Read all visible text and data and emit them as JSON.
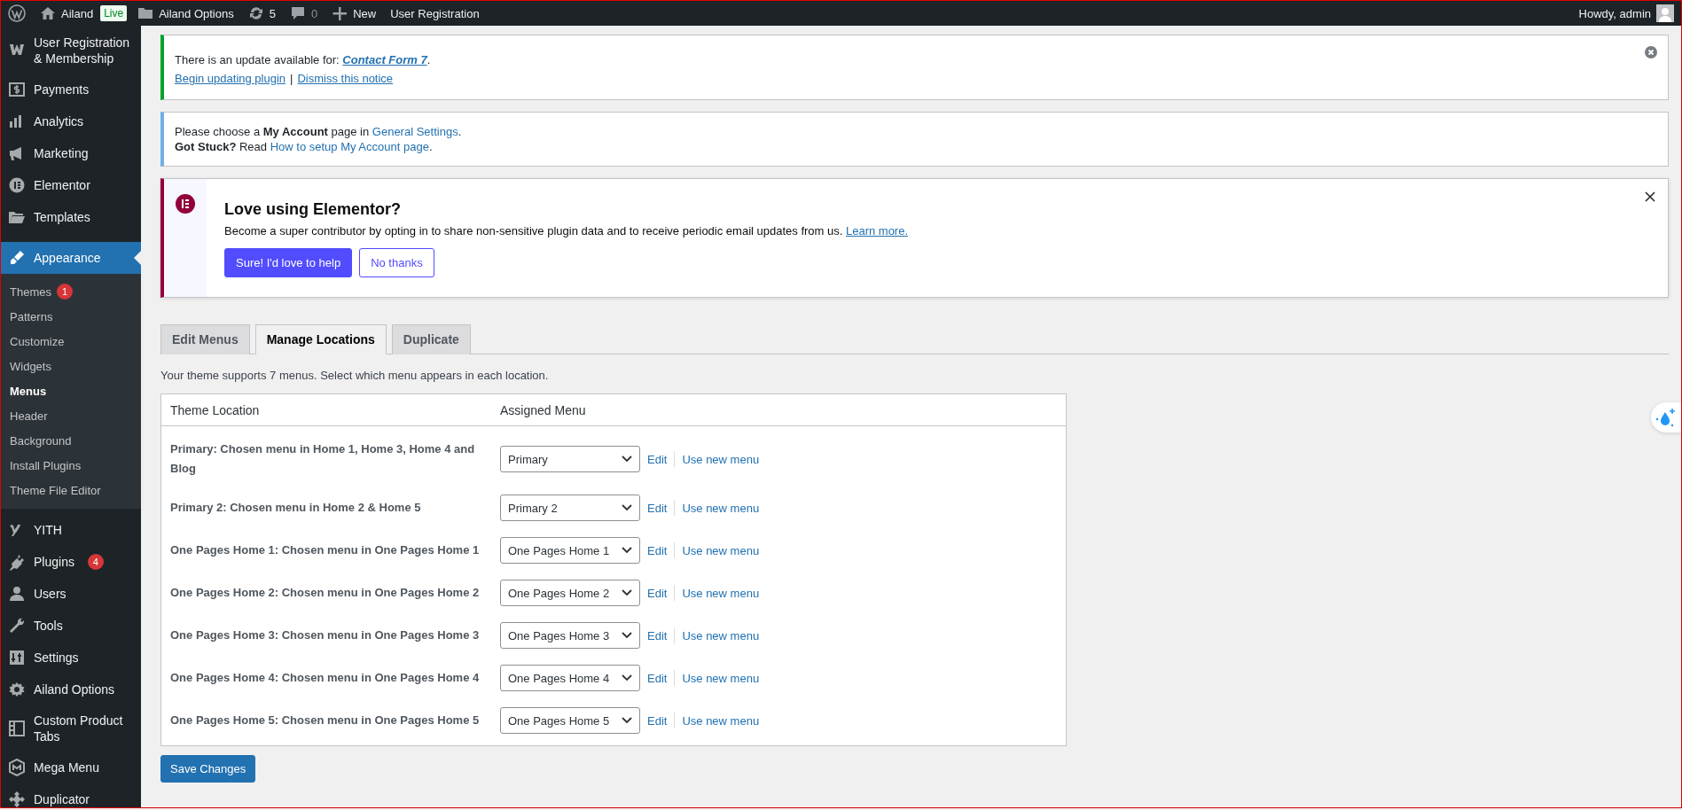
{
  "admin_bar": {
    "site": "Ailand",
    "badge": "Live",
    "items": [
      {
        "label": "Ailand Options"
      },
      {
        "label": "5"
      },
      {
        "label": "0"
      },
      {
        "label": "New"
      },
      {
        "label": "User Registration"
      }
    ],
    "greeting": "Howdy, admin"
  },
  "sidebar": {
    "items": [
      {
        "label": "User Registration & Membership",
        "selected": false
      },
      {
        "label": "Payments",
        "selected": false
      },
      {
        "label": "Analytics",
        "selected": false
      },
      {
        "label": "Marketing",
        "selected": false
      },
      {
        "label": "Elementor",
        "selected": false
      },
      {
        "label": "Templates",
        "selected": false
      },
      {
        "label": "Appearance",
        "selected": true,
        "children": [
          {
            "label": "Themes",
            "selected": false,
            "badge": "1"
          },
          {
            "label": "Patterns",
            "selected": false
          },
          {
            "label": "Customize",
            "selected": false
          },
          {
            "label": "Widgets",
            "selected": false
          },
          {
            "label": "Menus",
            "selected": true
          },
          {
            "label": "Header",
            "selected": false
          },
          {
            "label": "Background",
            "selected": false
          },
          {
            "label": "Install Plugins",
            "selected": false
          },
          {
            "label": "Theme File Editor",
            "selected": false
          }
        ]
      },
      {
        "label": "YITH",
        "selected": false
      },
      {
        "label": "Plugins",
        "selected": false,
        "badge": "4"
      },
      {
        "label": "Users",
        "selected": false
      },
      {
        "label": "Tools",
        "selected": false
      },
      {
        "label": "Settings",
        "selected": false
      },
      {
        "label": "Ailand Options",
        "selected": false
      },
      {
        "label": "Custom Product Tabs",
        "selected": false
      },
      {
        "label": "Mega Menu",
        "selected": false
      },
      {
        "label": "Duplicator",
        "selected": false
      }
    ]
  },
  "update_notice": {
    "text": "There is an update available for: ",
    "link": "Contact Form 7",
    "after": ".",
    "actions": [
      "Begin updating plugin",
      "Dismiss this notice"
    ],
    "separator": "|"
  },
  "account_notice": {
    "lines": [
      {
        "text": "Please choose a **My Account** page in ",
        "link": "General Settings",
        "after": "."
      },
      {
        "text": "**Got Stuck?** Read ",
        "link": "How to setup My Account page",
        "after": "."
      }
    ]
  },
  "elementor_notice": {
    "title": "Love using Elementor?",
    "text": "Become a super contributor by opting in to share non-sensitive plugin data and to receive periodic email updates from us. ",
    "link": "Learn more.",
    "primary_button": "Sure! I'd love to help",
    "secondary_button": "No thanks"
  },
  "tabs": [
    {
      "label": "Edit Menus",
      "selected": false
    },
    {
      "label": "Manage Locations",
      "selected": true
    },
    {
      "label": "Duplicate",
      "selected": false
    }
  ],
  "description": "Your theme supports 7 menus. Select which menu appears in each location.",
  "table": {
    "columns": [
      "Theme Location",
      "Assigned Menu"
    ],
    "rows": [
      {
        "location": "Primary: Chosen menu in Home 1, Home 3, Home 4 and Blog",
        "menu": "Primary",
        "edit": "Edit",
        "new": "Use new menu"
      },
      {
        "location": "Primary 2: Chosen menu in Home 2 & Home 5",
        "menu": "Primary 2",
        "edit": "Edit",
        "new": "Use new menu"
      },
      {
        "location": "One Pages Home 1: Chosen menu in One Pages Home 1",
        "menu": "One Pages Home 1",
        "edit": "Edit",
        "new": "Use new menu"
      },
      {
        "location": "One Pages Home 2: Chosen menu in One Pages Home 2",
        "menu": "One Pages Home 2",
        "edit": "Edit",
        "new": "Use new menu"
      },
      {
        "location": "One Pages Home 3: Chosen menu in One Pages Home 3",
        "menu": "One Pages Home 3",
        "edit": "Edit",
        "new": "Use new menu"
      },
      {
        "location": "One Pages Home 4: Chosen menu in One Pages Home 4",
        "menu": "One Pages Home 4",
        "edit": "Edit",
        "new": "Use new menu"
      },
      {
        "location": "One Pages Home 5: Chosen menu in One Pages Home 5",
        "menu": "One Pages Home 5",
        "edit": "Edit",
        "new": "Use new menu"
      }
    ]
  },
  "save_button": "Save Changes"
}
